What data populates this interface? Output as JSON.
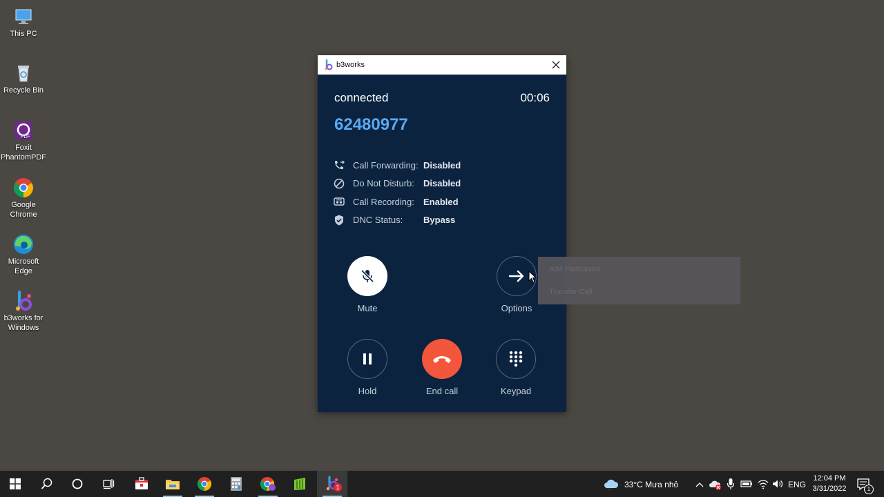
{
  "desktop": {
    "icons": [
      {
        "label": "This PC"
      },
      {
        "label": "Recycle Bin"
      },
      {
        "label": "Foxit\nPhantomPDF"
      },
      {
        "label": "Google\nChrome"
      },
      {
        "label": "Microsoft\nEdge"
      },
      {
        "label": "b3works for\nWindows"
      }
    ]
  },
  "window": {
    "title": "b3works",
    "status": "connected",
    "timer": "00:06",
    "number": "62480977",
    "info": [
      {
        "label": "Call Forwarding:",
        "value": "Disabled",
        "icon": "call-forward-icon"
      },
      {
        "label": "Do Not Disturb:",
        "value": "Disabled",
        "icon": "do-not-disturb-icon"
      },
      {
        "label": "Call Recording:",
        "value": "Enabled",
        "icon": "recording-icon"
      },
      {
        "label": "DNC Status:",
        "value": "Bypass",
        "icon": "shield-check-icon"
      }
    ],
    "controls": {
      "mute": "Mute",
      "options": "Options",
      "hold": "Hold",
      "end_call": "End call",
      "keypad": "Keypad"
    },
    "colors": {
      "background": "#0c2340",
      "number": "#5aa9f0",
      "end_call": "#f4563c"
    }
  },
  "options_menu": {
    "items": [
      "Add Participant",
      "Transfer Call"
    ]
  },
  "taskbar": {
    "weather": "33°C  Mưa nhỏ",
    "language": "ENG",
    "time": "12:04 PM",
    "date": "3/31/2022",
    "notification_badge": "1",
    "app_badge": "1"
  }
}
